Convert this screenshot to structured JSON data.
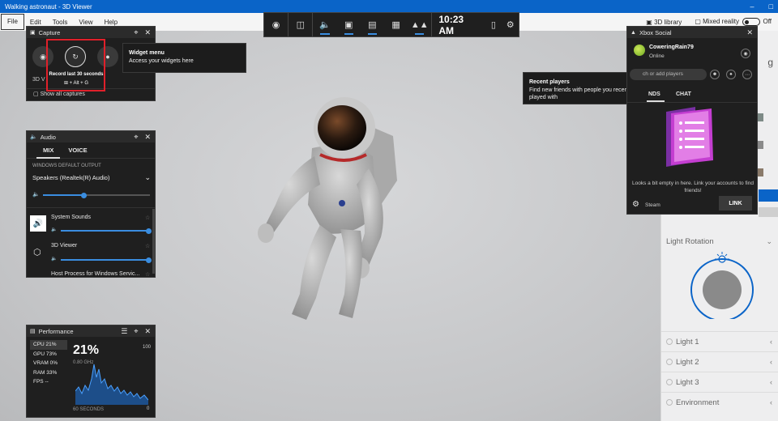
{
  "window": {
    "title": "Walking astronaut - 3D Viewer",
    "minimize_glyph": "–",
    "maximize_glyph": "□"
  },
  "menu": {
    "items": [
      "File",
      "Edit",
      "Tools",
      "View",
      "Help"
    ],
    "library_label": "3D library",
    "mixed_reality_label": "Mixed reality",
    "toggle_state": "Off"
  },
  "gamebar": {
    "time": "10:23 AM",
    "buttons": [
      "xbox-icon",
      "widget-menu-icon",
      "audio-icon",
      "capture-icon",
      "performance-icon",
      "resources-icon",
      "social-icon",
      "controller-icon",
      "settings-icon"
    ]
  },
  "capture": {
    "title": "Capture",
    "record_label": "Record last 30 seconds",
    "record_keys": "⊞ + Alt + G",
    "partial_label": "3D V",
    "show_all": "Show all captures"
  },
  "widget_tooltip": {
    "title": "Widget menu",
    "text": "Access your widgets here"
  },
  "recent_players": {
    "title": "Recent players",
    "text": "Find new friends with people you recently played with"
  },
  "audio": {
    "title": "Audio",
    "tabs": [
      "MIX",
      "VOICE"
    ],
    "output_heading": "WINDOWS DEFAULT OUTPUT",
    "device": "Speakers (Realtek(R) Audio)",
    "apps": [
      {
        "name": "System Sounds",
        "volume": 1.0
      },
      {
        "name": "3D Viewer",
        "volume": 1.0
      },
      {
        "name": "Host Process for Windows Servic..."
      }
    ],
    "master_volume": 0.38
  },
  "performance": {
    "title": "Performance",
    "metrics": [
      {
        "label": "CPU",
        "value": "21%"
      },
      {
        "label": "GPU",
        "value": "73%"
      },
      {
        "label": "VRAM",
        "value": "0%"
      },
      {
        "label": "RAM",
        "value": "33%"
      },
      {
        "label": "FPS",
        "value": "--"
      }
    ],
    "big_value": "21%",
    "freq": "0.80 GHz",
    "max": "100",
    "min": "0",
    "timespan": "60 SECONDS"
  },
  "social": {
    "title": "Xbox Social",
    "username": "CoweringRain79",
    "status": "Online",
    "search_placeholder": "ch or add players",
    "tabs": [
      "NDS",
      "CHAT"
    ],
    "empty_text": "Looks a bit empty in here. Link your accounts to find friends!",
    "steam_label": "Steam",
    "link_label": "LINK"
  },
  "right_panel": {
    "partial_title": "g",
    "light_rotation": "Light Rotation",
    "lights": [
      "Light 1",
      "Light 2",
      "Light 3",
      "Environment"
    ]
  },
  "colors": {
    "accent": "#0a64c8",
    "gamebar_accent": "#3a8de0",
    "highlight": "#e0202a"
  }
}
